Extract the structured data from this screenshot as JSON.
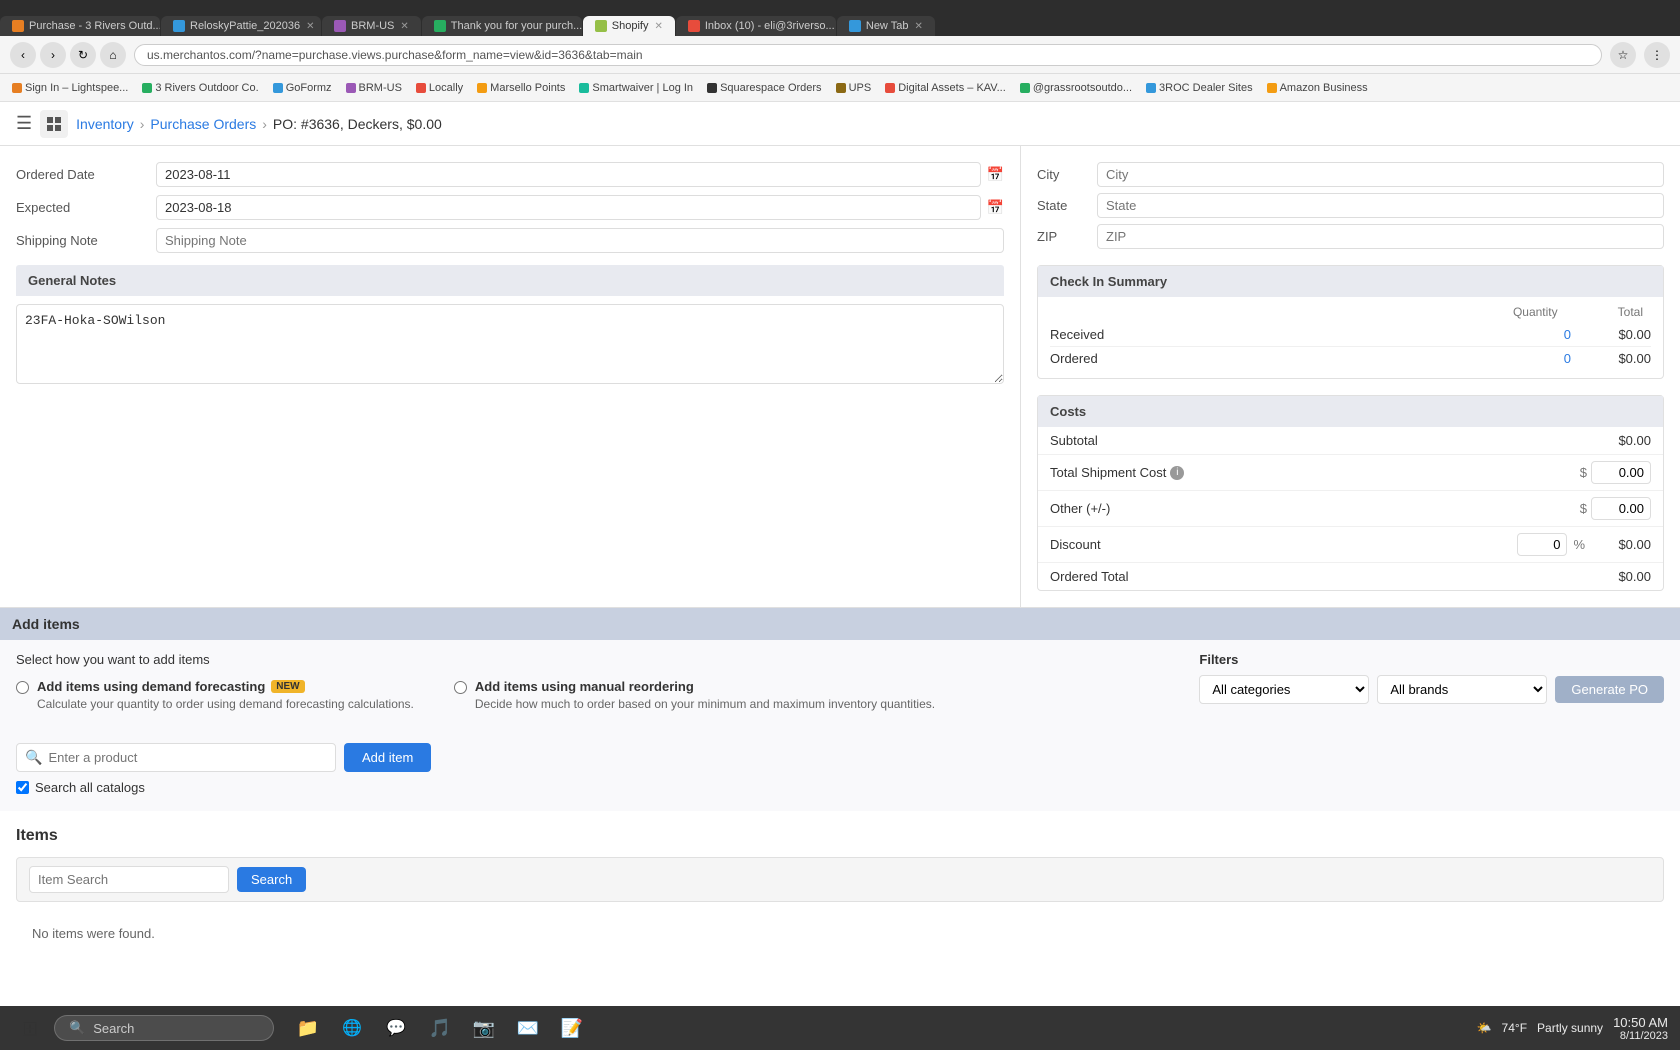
{
  "browser": {
    "tabs": [
      {
        "id": "tab1",
        "label": "Purchase - 3 Rivers Outd...",
        "active": false,
        "favicon_color": "#e67e22"
      },
      {
        "id": "tab2",
        "label": "ReloskyPattie_202036",
        "active": false,
        "favicon_color": "#3498db"
      },
      {
        "id": "tab3",
        "label": "BRM-US",
        "active": false,
        "favicon_color": "#9b59b6"
      },
      {
        "id": "tab4",
        "label": "Thank you for your purch...",
        "active": false,
        "favicon_color": "#27ae60"
      },
      {
        "id": "tab5",
        "label": "Shopify",
        "active": true,
        "favicon_color": "#95bf47"
      },
      {
        "id": "tab6",
        "label": "Inbox (10) - eli@3riverso...",
        "active": false,
        "favicon_color": "#e74c3c"
      },
      {
        "id": "tab7",
        "label": "New Tab",
        "active": false,
        "favicon_color": "#3498db"
      }
    ],
    "url": "us.merchantos.com/?name=purchase.views.purchase&form_name=view&id=3636&tab=main",
    "bookmarks": [
      {
        "label": "Sign In – Lightspee...",
        "color": "#e67e22"
      },
      {
        "label": "3 Rivers Outdoor Co.",
        "color": "#27ae60"
      },
      {
        "label": "GoFormz",
        "color": "#3498db"
      },
      {
        "label": "BRM-US",
        "color": "#9b59b6"
      },
      {
        "label": "Locally",
        "color": "#e74c3c"
      },
      {
        "label": "Marsello Points",
        "color": "#f39c12"
      },
      {
        "label": "Smartwaiver | Log In",
        "color": "#1abc9c"
      },
      {
        "label": "Squarespace Orders",
        "color": "#333"
      },
      {
        "label": "UPS",
        "color": "#8B6914"
      },
      {
        "label": "Digital Assets – KAV...",
        "color": "#e74c3c"
      },
      {
        "label": "@grassrootsoutdo...",
        "color": "#27ae60"
      },
      {
        "label": "3ROC Dealer Sites",
        "color": "#3498db"
      },
      {
        "label": "Amazon Business",
        "color": "#f39c12"
      }
    ]
  },
  "app": {
    "nav": {
      "breadcrumb_home": "Inventory",
      "breadcrumb_mid": "Purchase Orders",
      "breadcrumb_current": "PO: #3636, Deckers, $0.00"
    }
  },
  "form": {
    "ordered_date_label": "Ordered Date",
    "ordered_date_value": "2023-08-11",
    "expected_label": "Expected",
    "expected_value": "2023-08-18",
    "shipping_note_label": "Shipping Note",
    "shipping_note_placeholder": "Shipping Note",
    "general_notes_header": "General Notes",
    "general_notes_value": "23FA-Hoka-SOWilson"
  },
  "address": {
    "city_label": "City",
    "city_placeholder": "City",
    "state_label": "State",
    "state_placeholder": "State",
    "zip_label": "ZIP",
    "zip_placeholder": "ZIP"
  },
  "check_in_summary": {
    "header": "Check In Summary",
    "col_quantity": "Quantity",
    "col_total": "Total",
    "received_label": "Received",
    "received_qty": "0",
    "received_total": "$0.00",
    "ordered_label": "Ordered",
    "ordered_qty": "0",
    "ordered_total": "$0.00"
  },
  "costs": {
    "header": "Costs",
    "subtotal_label": "Subtotal",
    "subtotal_value": "$0.00",
    "shipment_label": "Total Shipment Cost",
    "shipment_symbol": "$",
    "shipment_value": "0.00",
    "other_label": "Other (+/-)",
    "other_symbol": "$",
    "other_value": "0.00",
    "discount_label": "Discount",
    "discount_qty": "0",
    "discount_pct": "%",
    "discount_value": "$0.00",
    "ordered_total_label": "Ordered Total",
    "ordered_total_value": "$0.00"
  },
  "add_items": {
    "section_header": "Add items",
    "select_method_label": "Select how you want to add items",
    "radio1_label": "Add items using demand forecasting",
    "radio1_badge": "NEW",
    "radio1_desc": "Calculate your quantity to order using demand forecasting calculations.",
    "radio2_label": "Add items using manual reordering",
    "radio2_desc": "Decide how much to order based on your minimum and maximum inventory quantities.",
    "filters_label": "Filters",
    "category_placeholder": "All categories",
    "brand_placeholder": "All brands",
    "generate_btn": "Generate PO",
    "search_placeholder": "Enter a product",
    "add_item_btn": "Add item",
    "search_all_catalogs_label": "Search all catalogs"
  },
  "items": {
    "header": "Items",
    "search_placeholder": "Item Search",
    "search_btn": "Search",
    "no_items_message": "No items were found."
  },
  "taskbar": {
    "search_text": "Search",
    "time": "10:50 AM",
    "date": "8/11/2023",
    "weather": "74°F",
    "weather_desc": "Partly sunny"
  }
}
